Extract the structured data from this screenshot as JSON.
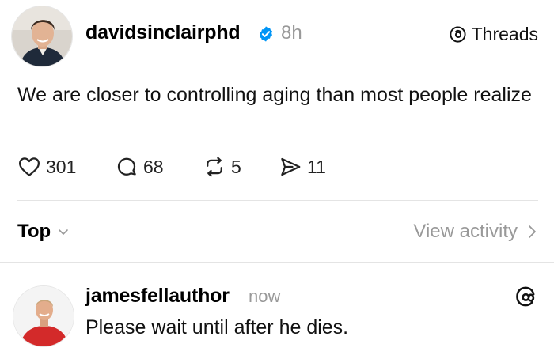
{
  "post": {
    "username": "davidsinclairphd",
    "time": "8h",
    "source_label": "Threads",
    "text": "We are closer to controlling aging than most people realize",
    "stats": {
      "likes": "301",
      "comments": "68",
      "reposts": "5",
      "shares": "11"
    }
  },
  "sort": {
    "label": "Top",
    "view_activity_label": "View activity"
  },
  "reply": {
    "username": "jamesfellauthor",
    "time": "now",
    "text": "Please wait until after he dies."
  },
  "icons": {
    "verified": "verified-badge-icon",
    "threads": "threads-logo-icon",
    "like": "heart-icon",
    "comment": "comment-bubble-icon",
    "repost": "repost-icon",
    "share": "share-send-icon",
    "sort_chevron": "chevron-down-icon",
    "activity_chevron": "chevron-right-icon"
  },
  "colors": {
    "verified_blue": "#0095f6",
    "muted_gray": "#999999",
    "divider": "#e4e4e4"
  }
}
